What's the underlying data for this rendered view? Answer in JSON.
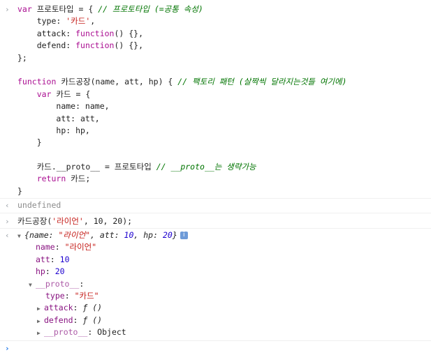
{
  "code_block": {
    "l1_kw": "var",
    "l1_name": " 프로토타입 = { ",
    "l1_cmt": "// 프로토타입 (=공통 속성)",
    "l2_key": "type: ",
    "l2_val": "'카드'",
    "l2_tail": ",",
    "l3_key": "attack: ",
    "l3_fn": "function",
    "l3_tail": "() {},",
    "l4_key": "defend: ",
    "l4_fn": "function",
    "l4_tail": "() {},",
    "l5": "};",
    "l7_kw": "function",
    "l7_sig": " 카드공장(name, att, hp) { ",
    "l7_cmt": "// 팩토리 패턴 (살짝씩 달라지는것들 여기에)",
    "l8_kw": "var",
    "l8_rest": " 카드 = {",
    "l9": "name: name,",
    "l10": "att: att,",
    "l11": "hp: hp,",
    "l12": "}",
    "l14_code": "카드.__proto__ = 프로토타입 ",
    "l14_cmt": "// __proto__는 생략가능",
    "l15_kw": "return",
    "l15_rest": " 카드;",
    "l16": "}"
  },
  "result1": "undefined",
  "call": {
    "fn": "카드공장(",
    "arg1": "'라이언'",
    "rest": ", 10, 20);"
  },
  "object_summary": {
    "open": "{",
    "name_key": "name: ",
    "name_val": "\"라이언\"",
    "att_key": ", att: ",
    "att_val": "10",
    "hp_key": ", hp: ",
    "hp_val": "20",
    "close": "}",
    "info": "i"
  },
  "tree": {
    "name_key": "name",
    "name_val": "\"라이언\"",
    "att_key": "att",
    "att_val": "10",
    "hp_key": "hp",
    "hp_val": "20",
    "proto_key": "__proto__",
    "type_key": "type",
    "type_val": "\"카드\"",
    "attack_key": "attack",
    "attack_val": "ƒ ()",
    "defend_key": "defend",
    "defend_val": "ƒ ()",
    "proto2_key": "__proto__",
    "proto2_val": "Object"
  },
  "icons": {
    "prompt": "›",
    "result": "‹",
    "expanded": "▼",
    "collapsed": "▶"
  }
}
